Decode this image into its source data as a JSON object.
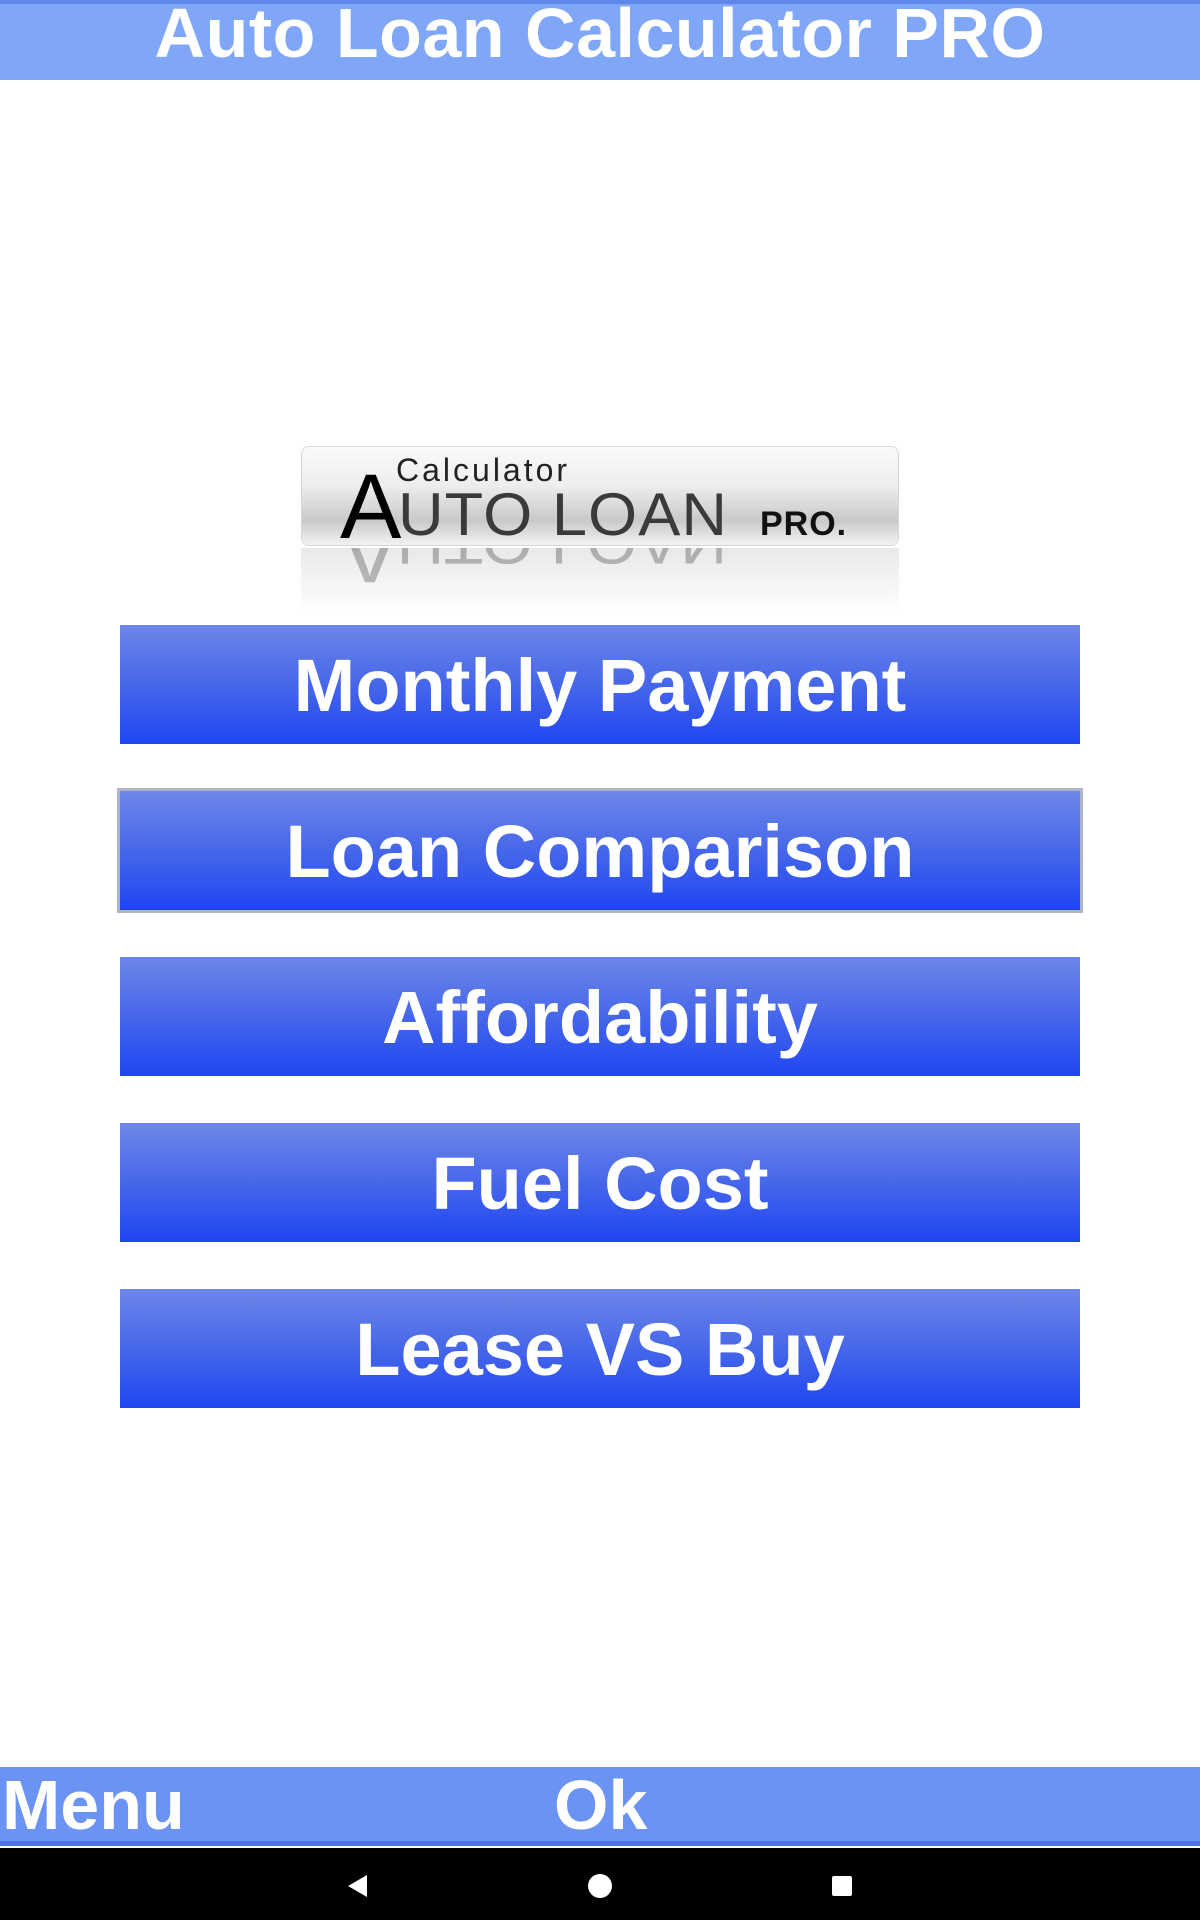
{
  "title_bar": {
    "title": "Auto Loan Calculator PRO"
  },
  "logo": {
    "line_calculator": "Calculator",
    "line_big_a": "A",
    "line_auto_loan": "UTO LOAN",
    "line_pro": "PRO."
  },
  "menu": {
    "items": [
      {
        "label": "Monthly Payment"
      },
      {
        "label": "Loan Comparison"
      },
      {
        "label": "Affordability"
      },
      {
        "label": "Fuel Cost"
      },
      {
        "label": "Lease VS Buy"
      }
    ],
    "focused_index": 1
  },
  "action_bar": {
    "menu_label": "Menu",
    "ok_label": "Ok"
  },
  "system_nav": {
    "back_icon": "back-triangle-icon",
    "home_icon": "home-circle-icon",
    "recents_icon": "recents-square-icon"
  },
  "colors": {
    "title_bar_bg": "#7fa6f7",
    "button_gradient_top": "#6d87e8",
    "button_gradient_bottom": "#1f46f2",
    "action_bar_bg": "#6b93f3",
    "nav_bar_bg": "#000000"
  }
}
